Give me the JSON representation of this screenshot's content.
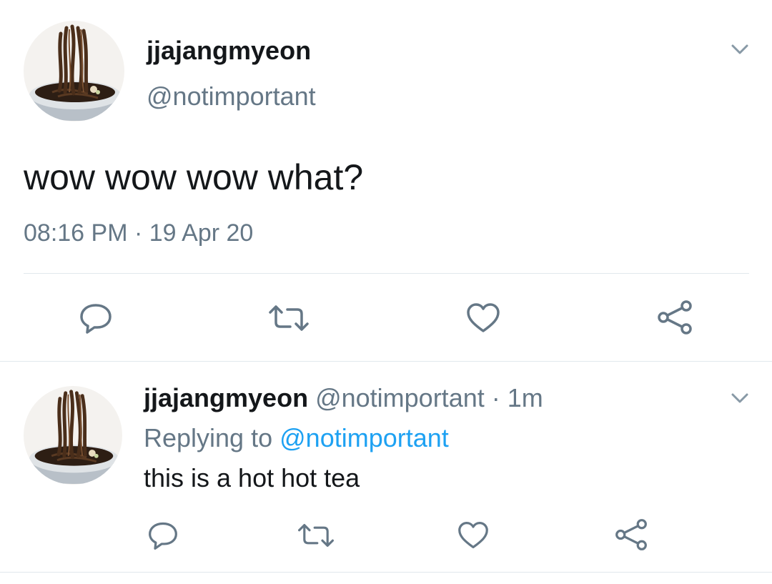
{
  "main_tweet": {
    "display_name": "jjajangmyeon",
    "handle": "@notimportant",
    "text": "wow wow wow what?",
    "time": "08:16 PM",
    "separator": "·",
    "date": "19 Apr 20",
    "menu_icon": "chevron-down-icon",
    "actions": [
      "reply-icon",
      "retweet-icon",
      "like-icon",
      "share-icon"
    ]
  },
  "reply_tweet": {
    "display_name": "jjajangmyeon",
    "handle": "@notimportant",
    "separator": "·",
    "age": "1m",
    "replying_prefix": "Replying to",
    "replying_handle": "@notimportant",
    "text": "this is a hot hot tea",
    "menu_icon": "chevron-down-icon",
    "actions": [
      "reply-icon",
      "retweet-icon",
      "like-icon",
      "share-icon"
    ]
  },
  "colors": {
    "text": "#14171a",
    "muted": "#657786",
    "link": "#1da1f2",
    "divider": "#e1e8ed",
    "icon": "#657786"
  }
}
